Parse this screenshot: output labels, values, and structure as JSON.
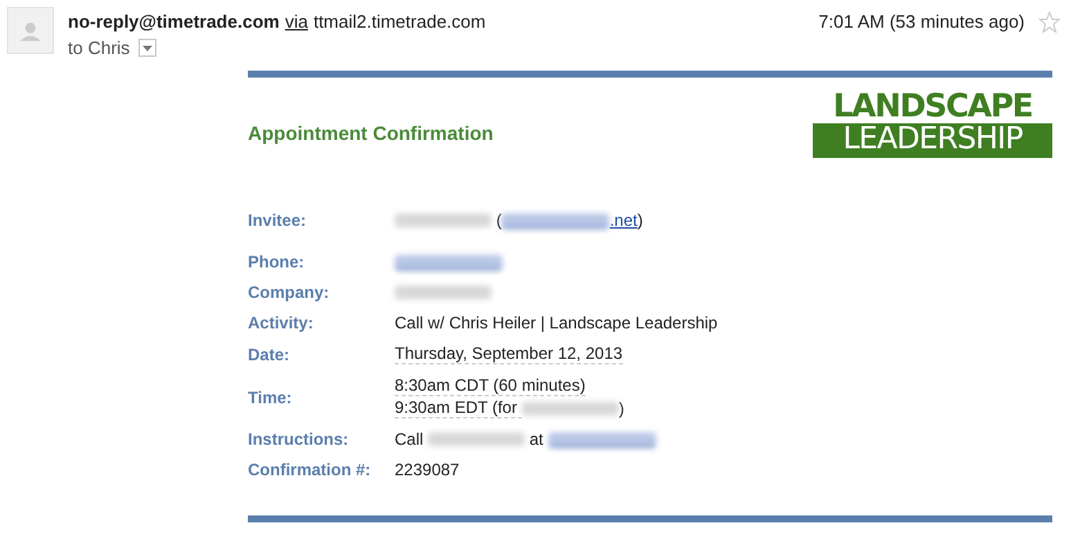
{
  "header": {
    "sender": "no-reply@timetrade.com",
    "via": "via",
    "relay": "ttmail2.timetrade.com",
    "recipient": "to Chris",
    "time": "7:01 AM (53 minutes ago)",
    "starred": false
  },
  "logo": {
    "line_1": "LANDSCAPE",
    "line_2": "LEADERSHIP"
  },
  "title": "Appointment Confirmation",
  "fields": [
    {
      "label": "Invitee:",
      "lines": [
        [
          {
            "kind": "redacted"
          },
          {
            "kind": "text",
            "text": " ("
          },
          {
            "kind": "redacted_link"
          },
          {
            "kind": "link",
            "text": ".net"
          },
          {
            "kind": "text",
            "text": ")"
          }
        ]
      ]
    },
    {
      "label": "Phone:",
      "lines": [
        [
          {
            "kind": "redacted_link"
          }
        ]
      ]
    },
    {
      "label": "Company:",
      "lines": [
        [
          {
            "kind": "redacted"
          }
        ]
      ]
    },
    {
      "label": "Activity:",
      "lines": [
        [
          {
            "kind": "text",
            "text": "Call w/ Chris Heiler | Landscape Leadership"
          }
        ]
      ]
    },
    {
      "label": "Date:",
      "lines": [
        [
          {
            "kind": "detected",
            "text": "Thursday, September 12, 2013"
          }
        ]
      ]
    },
    {
      "label": "Time:",
      "lines": [
        [
          {
            "kind": "detected",
            "text": "8:30am CDT (60 minutes)"
          }
        ],
        [
          {
            "kind": "detected",
            "text": "9:30am EDT (for "
          },
          {
            "kind": "redacted"
          },
          {
            "kind": "text",
            "text": ")"
          }
        ]
      ]
    },
    {
      "label": "Instructions:",
      "lines": [
        [
          {
            "kind": "text",
            "text": "Call "
          },
          {
            "kind": "redacted"
          },
          {
            "kind": "text",
            "text": " at "
          },
          {
            "kind": "redacted_link"
          }
        ]
      ]
    },
    {
      "label": "Confirmation #:",
      "lines": [
        [
          {
            "kind": "text",
            "text": "2239087"
          }
        ]
      ]
    }
  ]
}
